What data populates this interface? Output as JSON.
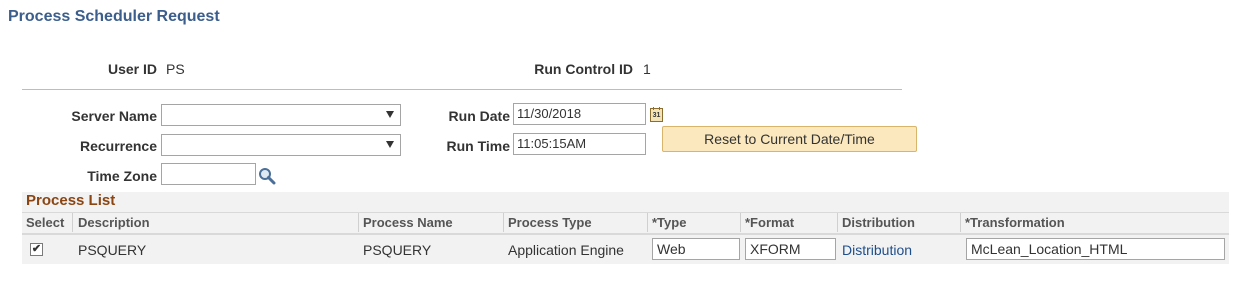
{
  "page": {
    "title": "Process Scheduler Request"
  },
  "header": {
    "user_id_label": "User ID",
    "user_id_value": "PS",
    "run_control_label": "Run Control ID",
    "run_control_value": "1"
  },
  "form": {
    "server_name_label": "Server Name",
    "server_name_value": "",
    "recurrence_label": "Recurrence",
    "recurrence_value": "",
    "time_zone_label": "Time Zone",
    "time_zone_value": "",
    "run_date_label": "Run Date",
    "run_date_value": "11/30/2018",
    "run_time_label": "Run Time",
    "run_time_value": "11:05:15AM",
    "calendar_icon_text": "31",
    "reset_button_label": "Reset to Current Date/Time"
  },
  "process_list": {
    "title": "Process List",
    "columns": [
      "Select",
      "Description",
      "Process Name",
      "Process Type",
      "*Type",
      "*Format",
      "Distribution",
      "*Transformation"
    ],
    "rows": [
      {
        "selected": true,
        "description": "PSQUERY",
        "process_name": "PSQUERY",
        "process_type": "Application Engine",
        "type": "Web",
        "format": "XFORM",
        "distribution": "Distribution",
        "transformation": "McLean_Location_HTML"
      }
    ]
  },
  "colors": {
    "title": "#3b5e8c",
    "grid_title": "#8b4513",
    "link": "#1f4e8c",
    "button_bg": "#fbe8be"
  }
}
